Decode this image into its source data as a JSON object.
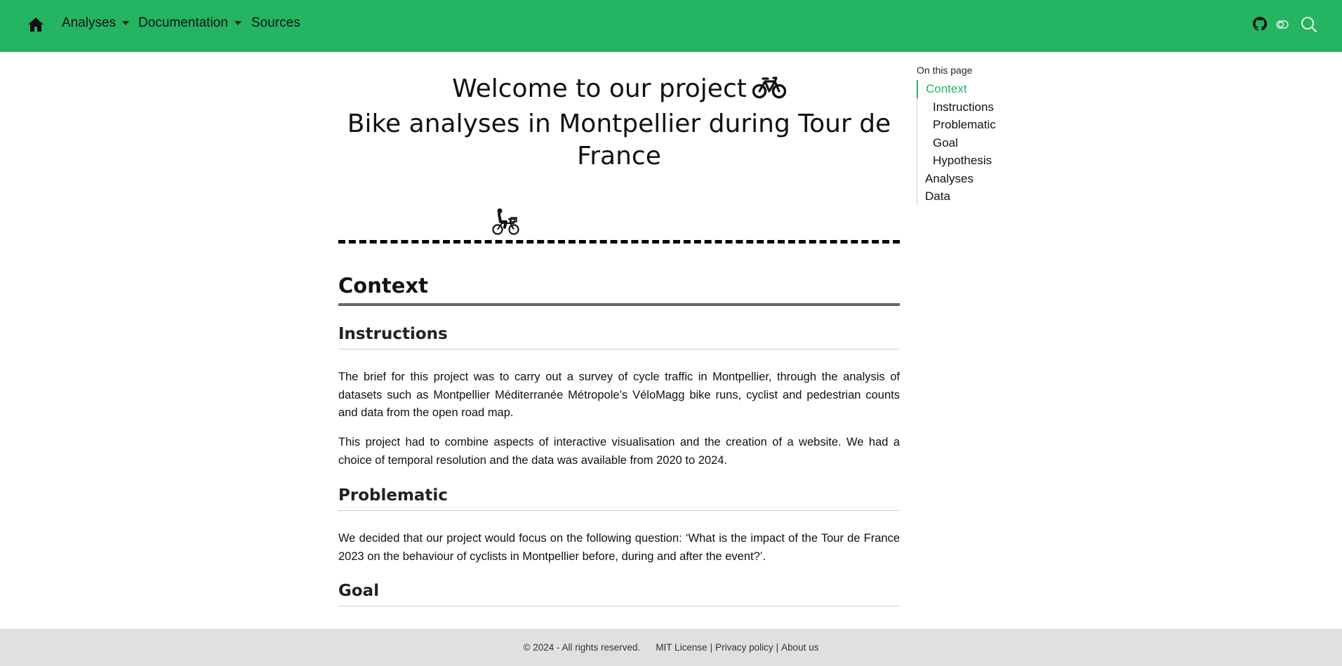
{
  "navbar": {
    "background": "#24b462",
    "home_icon": "home-icon",
    "items": [
      {
        "label": "Analyses",
        "dropdown": true
      },
      {
        "label": "Documentation",
        "dropdown": true
      },
      {
        "label": "Sources",
        "dropdown": false
      }
    ],
    "right_icons": [
      "github-icon",
      "toggle-icon",
      "search-icon"
    ]
  },
  "hero": {
    "title_line1": "Welcome to our project",
    "title_line2": "Bike analyses in Montpellier during Tour de",
    "title_line3": "France",
    "title_icon": "bicycle-icon",
    "rider_icon": "cyclist-icon"
  },
  "content": {
    "context_heading": "Context",
    "instructions_heading": "Instructions",
    "instructions_p1": "The brief for this project was to carry out a survey of cycle traffic in Montpellier, through the analysis of datasets such as Montpellier Méditerranée Métropole’s VéloMagg bike runs, cyclist and pedestrian counts and data from the open road map.",
    "instructions_p2": "This project had to combine aspects of interactive visualisation and the creation of a website. We had a choice of temporal resolution and the data was available from 2020 to 2024.",
    "problematic_heading": "Problematic",
    "problematic_p1": "We decided that our project would focus on the following question: ‘What is the impact of the Tour de France 2023 on the behaviour of cyclists in Montpellier before, during and after the event?’.",
    "goal_heading": "Goal"
  },
  "toc": {
    "heading": "On this page",
    "items": [
      {
        "label": "Context",
        "active": true,
        "sub": false
      },
      {
        "label": "Instructions",
        "active": false,
        "sub": true
      },
      {
        "label": "Problematic",
        "active": false,
        "sub": true
      },
      {
        "label": "Goal",
        "active": false,
        "sub": true
      },
      {
        "label": "Hypothesis",
        "active": false,
        "sub": true
      },
      {
        "label": "Analyses",
        "active": false,
        "sub": false
      },
      {
        "label": "Data",
        "active": false,
        "sub": false
      }
    ],
    "accent": "#24b462"
  },
  "footer": {
    "copyright": "© 2024 - All rights reserved.",
    "links": [
      "MIT License",
      "Privacy policy",
      "About us"
    ],
    "separator": "|",
    "background": "#dfe0e2"
  }
}
